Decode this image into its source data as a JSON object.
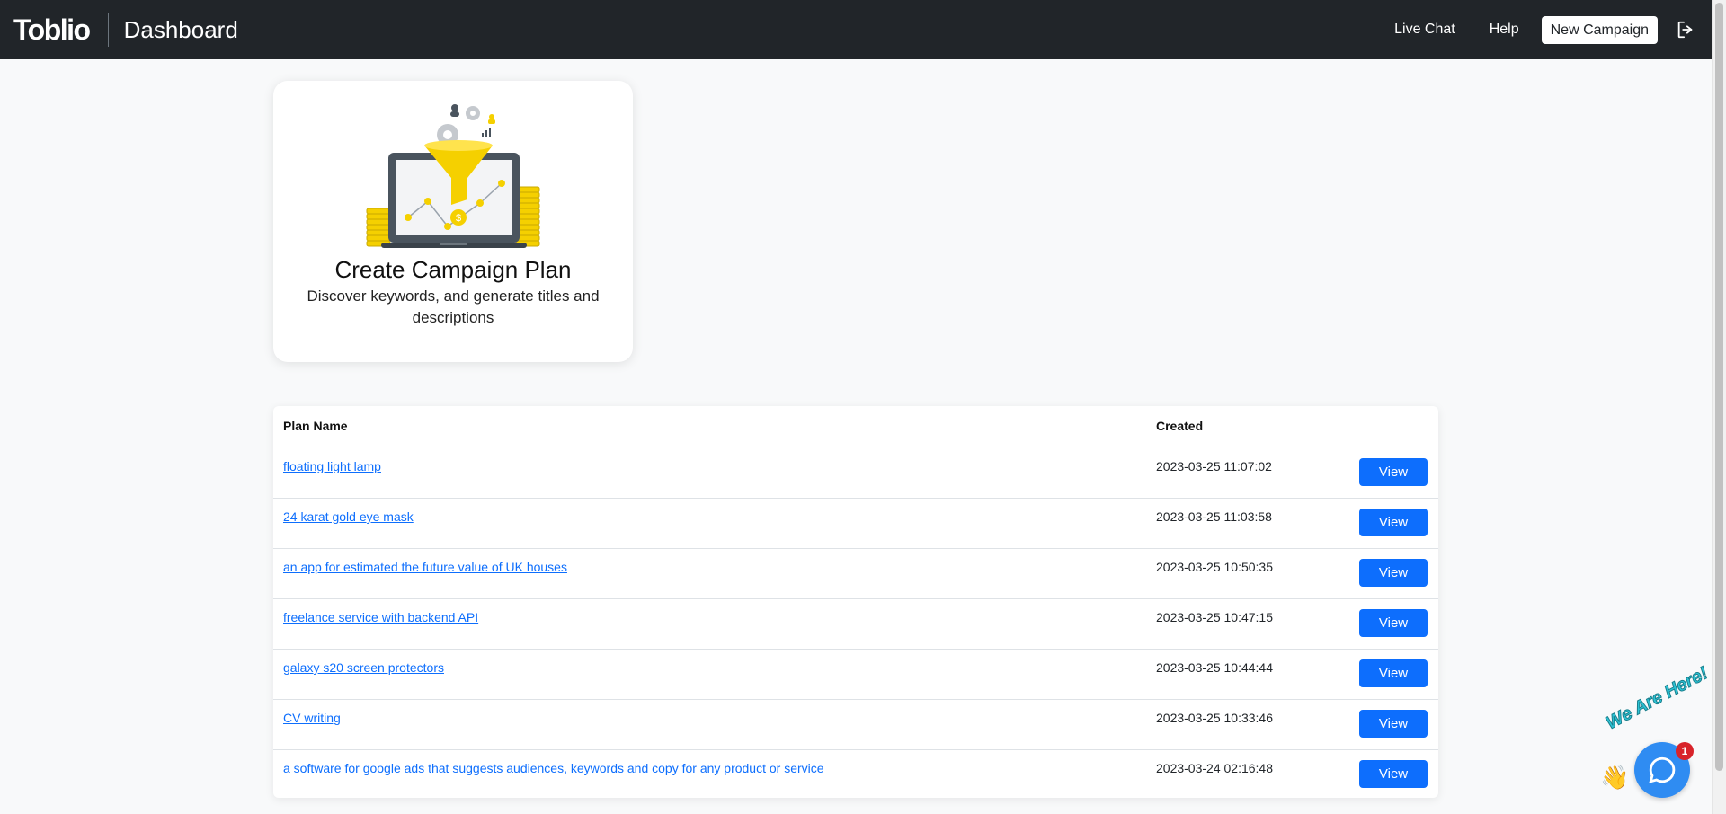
{
  "navbar": {
    "brand": "Toblio",
    "page_title": "Dashboard",
    "live_chat": "Live Chat",
    "help": "Help",
    "new_campaign": "New Campaign",
    "logout_icon": "logout-icon"
  },
  "card": {
    "title": "Create Campaign Plan",
    "description": "Discover keywords, and generate titles and descriptions",
    "illustration": "sales-funnel-laptop-illustration"
  },
  "table": {
    "headers": {
      "plan_name": "Plan Name",
      "created": "Created"
    },
    "rows": [
      {
        "name": "floating light lamp",
        "created": "2023-03-25 11:07:02",
        "action": "View"
      },
      {
        "name": "24 karat gold eye mask",
        "created": "2023-03-25 11:03:58",
        "action": "View"
      },
      {
        "name": "an app for estimated the future value of UK houses",
        "created": "2023-03-25 10:50:35",
        "action": "View"
      },
      {
        "name": "freelance service with backend API",
        "created": "2023-03-25 10:47:15",
        "action": "View"
      },
      {
        "name": "galaxy s20 screen protectors",
        "created": "2023-03-25 10:44:44",
        "action": "View"
      },
      {
        "name": "CV writing",
        "created": "2023-03-25 10:33:46",
        "action": "View"
      },
      {
        "name": "a software for google ads that suggests audiences, keywords and copy for any product or service",
        "created": "2023-03-24 02:16:48",
        "action": "View"
      }
    ]
  },
  "chat_widget": {
    "label": "We Are Here!",
    "badge": "1",
    "icon": "chat-bubble-icon"
  },
  "colors": {
    "navbar_bg": "#212529",
    "page_bg": "#f8f9fa",
    "primary": "#0d6efd",
    "funnel_yellow": "#f5d000",
    "chat_blue": "#2f8cf2",
    "badge_red": "#d8232a"
  }
}
